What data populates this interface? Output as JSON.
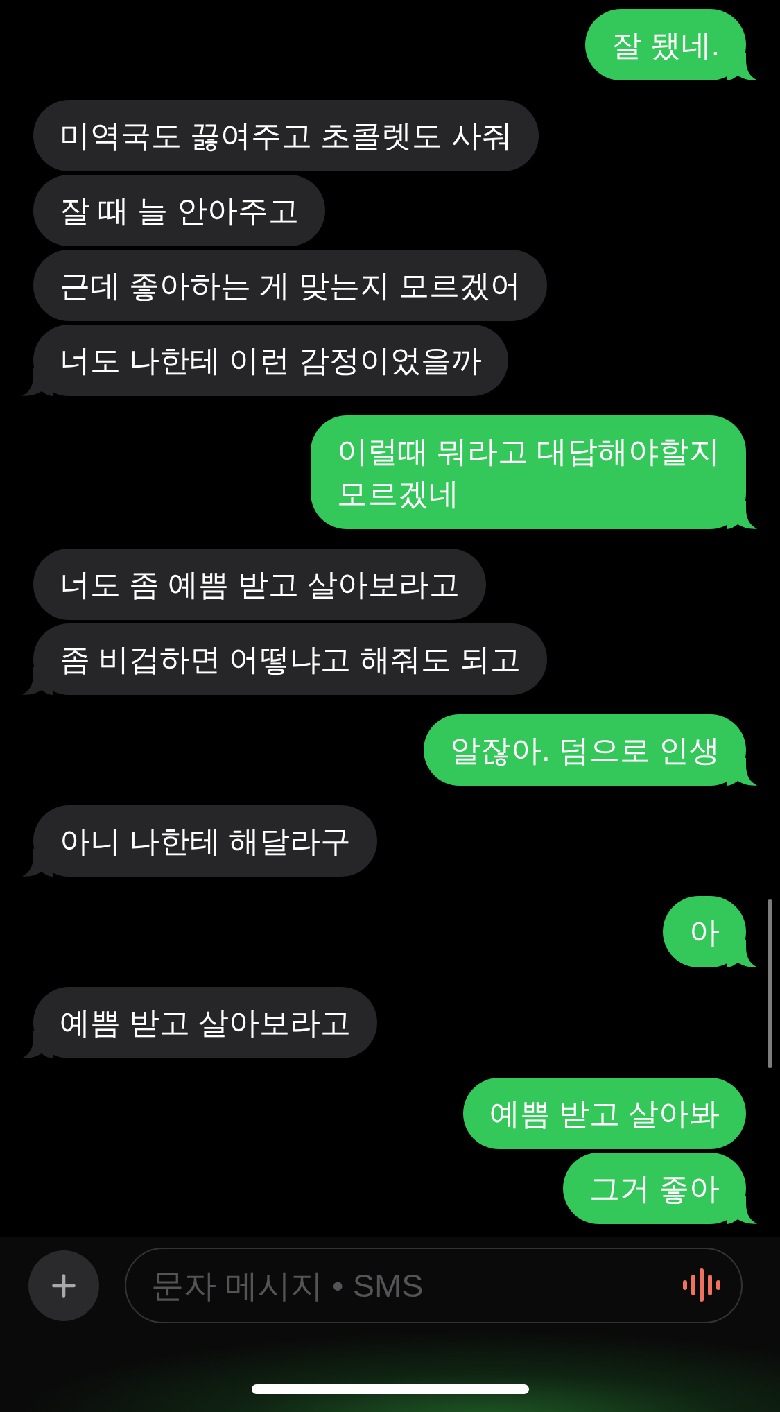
{
  "conversation": [
    {
      "kind": "sent",
      "messages": [
        "잘 됐네."
      ]
    },
    {
      "kind": "received",
      "messages": [
        "미역국도 끓여주고 초콜렛도 사줘",
        "잘 때 늘 안아주고",
        "근데 좋아하는 게 맞는지 모르겠어",
        "너도 나한테 이런 감정이었을까"
      ]
    },
    {
      "kind": "sent",
      "messages": [
        "이럴때 뭐라고 대답해야할지\n모르겠네"
      ]
    },
    {
      "kind": "received",
      "messages": [
        "너도 좀 예쁨 받고 살아보라고",
        "좀 비겁하면 어떻냐고 해줘도 되고"
      ]
    },
    {
      "kind": "sent",
      "messages": [
        "알잖아. 덤으로 인생"
      ]
    },
    {
      "kind": "received",
      "messages": [
        "아니 나한테 해달라구"
      ]
    },
    {
      "kind": "sent",
      "messages": [
        "아"
      ]
    },
    {
      "kind": "received",
      "messages": [
        "예쁨 받고 살아보라고"
      ]
    },
    {
      "kind": "sent",
      "messages": [
        "예쁨 받고 살아봐",
        "그거 좋아"
      ]
    }
  ],
  "compose": {
    "placeholder": "문자 메시지 • SMS"
  }
}
